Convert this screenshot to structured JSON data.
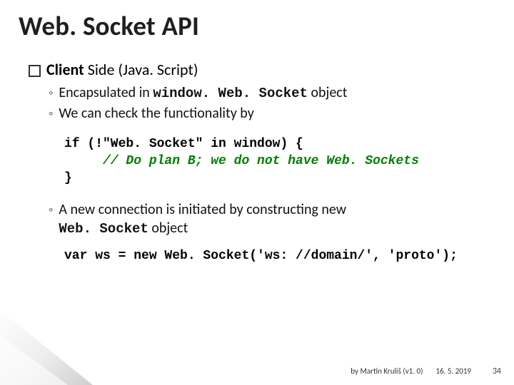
{
  "title": "Web. Socket API",
  "bullet1_prefix": "Client",
  "bullet1_rest": " Side (Java. Script)",
  "sub_bullets": {
    "a_prefix": "Encapsulated in ",
    "a_code": "window. Web. Socket",
    "a_suffix": " object",
    "b": "We can check the functionality by",
    "c_line1": "A new connection is initiated by constructing new",
    "c_code": "Web. Socket",
    "c_suffix": " object"
  },
  "code_block": {
    "line1": "if (!\"Web. Socket\" in window) {",
    "line2_indent": "     ",
    "line2_comment": "// Do plan B; we do not have Web. Sockets",
    "line3": "}"
  },
  "code_line2": "var ws = new Web. Socket('ws: //domain/', 'proto');",
  "footer": {
    "author": "by Martin Kruliš (v1. 0)",
    "date": "16. 5. 2019",
    "slide": "34"
  },
  "bullet_marker_l2": "◦"
}
